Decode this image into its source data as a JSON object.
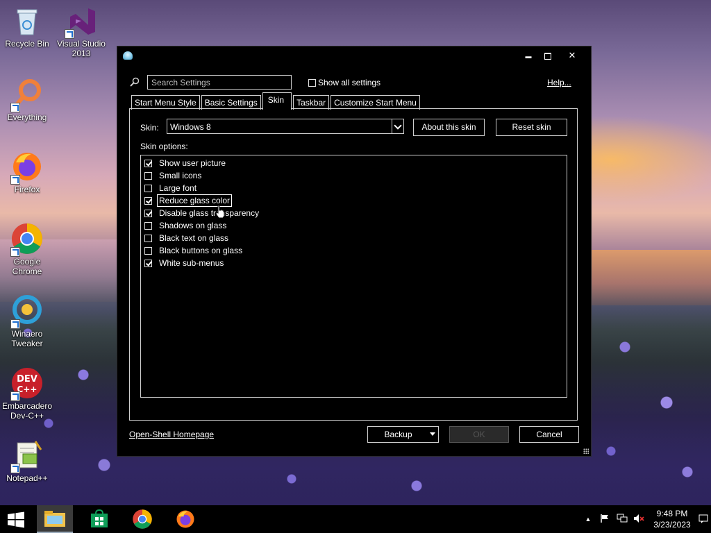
{
  "desktop": {
    "icons": [
      {
        "label": "Recycle Bin",
        "icon": "recycle-bin-icon"
      },
      {
        "label": "Visual Studio 2013",
        "icon": "visual-studio-icon"
      },
      {
        "label": "Everything",
        "icon": "everything-search-icon"
      },
      {
        "label": "Firefox",
        "icon": "firefox-icon"
      },
      {
        "label": "Google Chrome",
        "icon": "chrome-icon"
      },
      {
        "label": "Winaero Tweaker",
        "icon": "winaero-tweaker-icon"
      },
      {
        "label": "Embarcadero Dev-C++",
        "icon": "devcpp-icon"
      },
      {
        "label": "Notepad++",
        "icon": "notepadpp-icon"
      }
    ]
  },
  "dialog": {
    "window_buttons": {
      "minimize": "▬",
      "close": "✕"
    },
    "search": {
      "placeholder": "Search Settings",
      "value": ""
    },
    "show_all": {
      "label": "Show all settings",
      "checked": false
    },
    "help_label": "Help...",
    "tabs": [
      {
        "label": "Start Menu Style",
        "active": false
      },
      {
        "label": "Basic Settings",
        "active": false
      },
      {
        "label": "Skin",
        "active": true
      },
      {
        "label": "Taskbar",
        "active": false
      },
      {
        "label": "Customize Start Menu",
        "active": false
      }
    ],
    "skin": {
      "label": "Skin:",
      "selected": "Windows 8",
      "about_button": "About this skin",
      "reset_button": "Reset skin",
      "options_label": "Skin options:",
      "options": [
        {
          "label": "Show user picture",
          "checked": true
        },
        {
          "label": "Small icons",
          "checked": false
        },
        {
          "label": "Large font",
          "checked": false
        },
        {
          "label": "Reduce glass color",
          "checked": true,
          "focused": true
        },
        {
          "label": "Disable glass transparency",
          "checked": true
        },
        {
          "label": "Shadows on glass",
          "checked": false
        },
        {
          "label": "Black text on glass",
          "checked": false
        },
        {
          "label": "Black buttons on glass",
          "checked": false
        },
        {
          "label": "White sub-menus",
          "checked": true
        }
      ]
    },
    "footer": {
      "homepage_link": "Open-Shell Homepage",
      "backup_button": "Backup",
      "ok_button": "OK",
      "cancel_button": "Cancel"
    }
  },
  "taskbar": {
    "clock_time": "9:48 PM",
    "clock_date": "3/23/2023",
    "pinned": [
      "file-explorer-icon",
      "store-icon",
      "chrome-icon",
      "firefox-icon"
    ]
  }
}
